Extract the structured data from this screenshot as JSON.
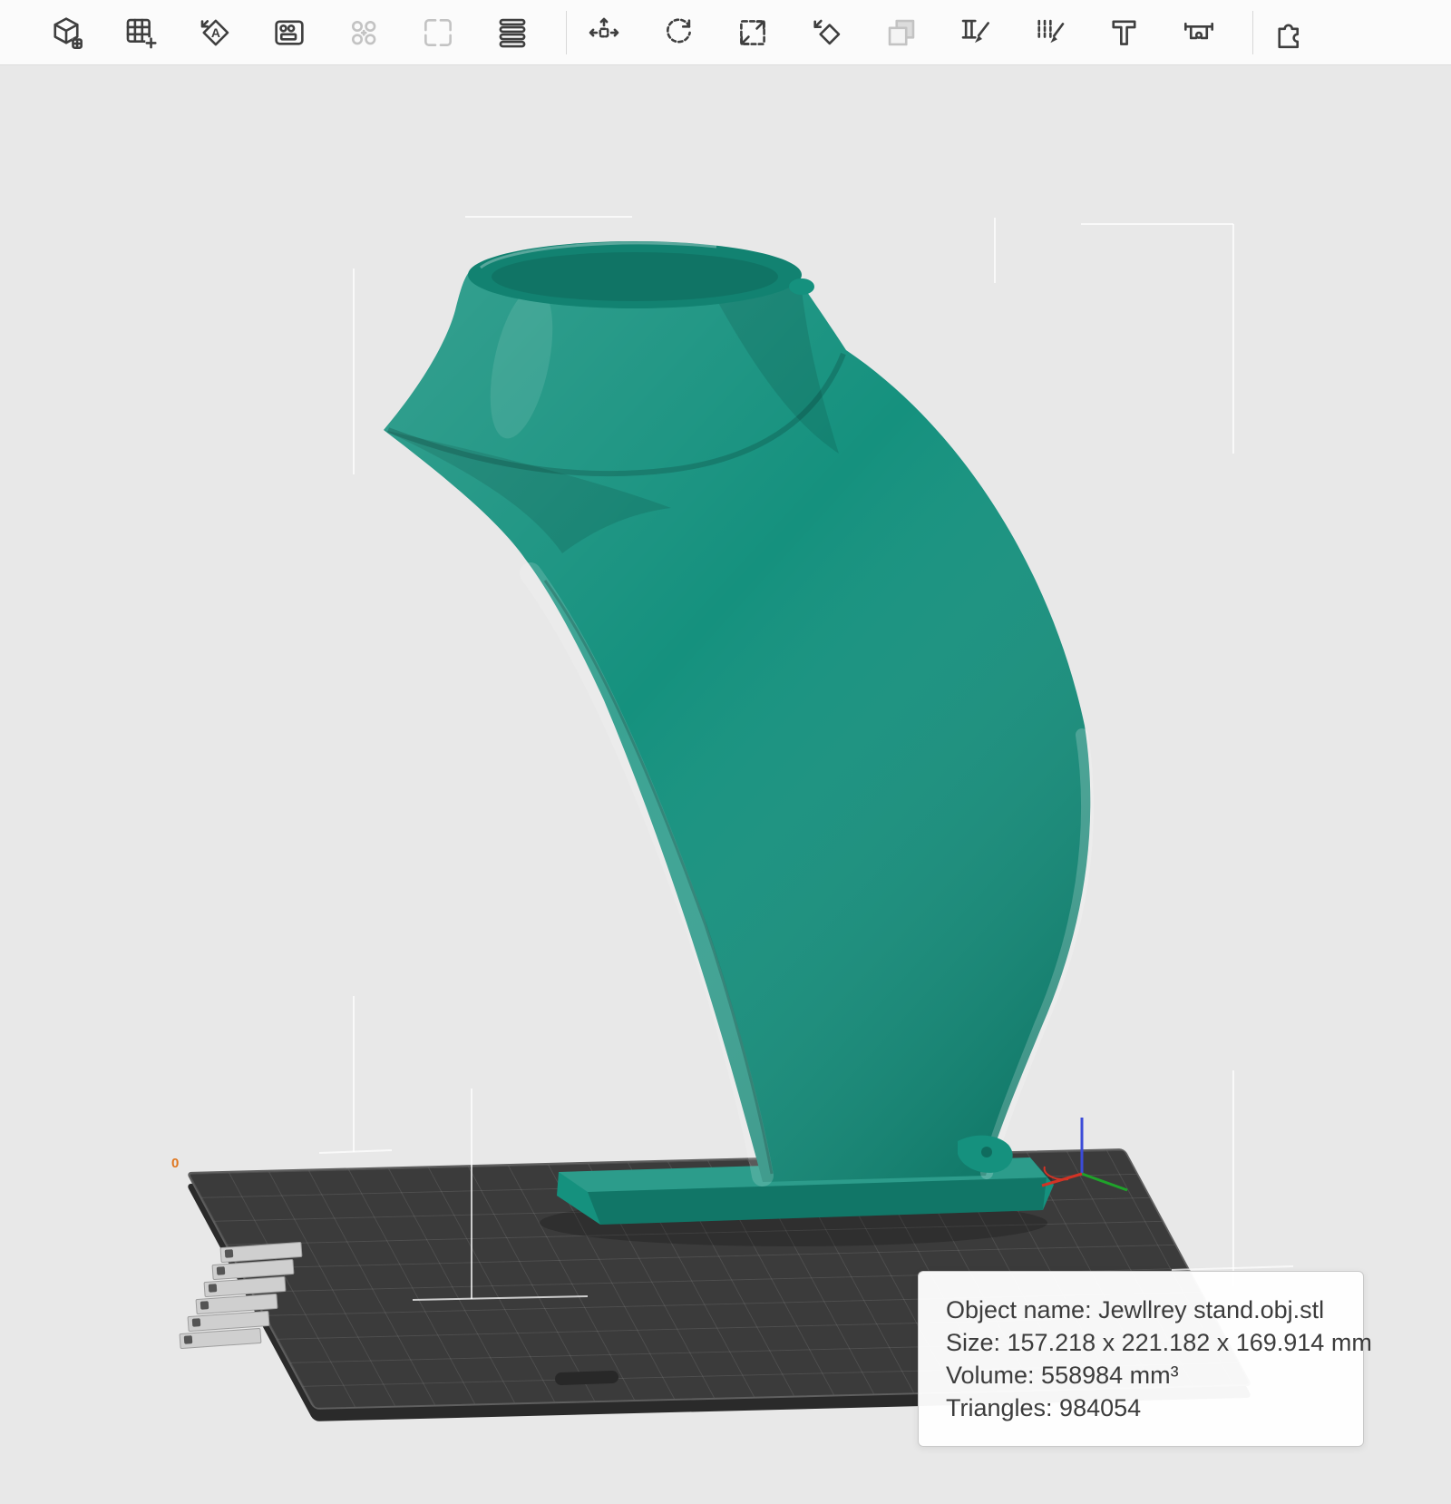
{
  "toolbar": {
    "auto_orient_letter": "A",
    "items": [
      {
        "name": "add-object",
        "disabled": false
      },
      {
        "name": "arrange",
        "disabled": false
      },
      {
        "name": "auto-orient",
        "disabled": false
      },
      {
        "name": "layout",
        "disabled": false
      },
      {
        "name": "clone",
        "disabled": true
      },
      {
        "name": "split",
        "disabled": true
      },
      {
        "name": "layers",
        "disabled": false
      },
      {
        "name": "move",
        "disabled": false
      },
      {
        "name": "rotate",
        "disabled": false
      },
      {
        "name": "scale",
        "disabled": false
      },
      {
        "name": "mirror",
        "disabled": false
      },
      {
        "name": "variable-layer-height",
        "disabled": true
      },
      {
        "name": "color-paint",
        "disabled": false
      },
      {
        "name": "support-paint",
        "disabled": false
      },
      {
        "name": "seam",
        "disabled": false
      },
      {
        "name": "measure",
        "disabled": false
      },
      {
        "name": "assembly",
        "disabled": false
      }
    ]
  },
  "viewport": {
    "origin_label": "0",
    "model_color": "#15917e",
    "plate_color": "#3b3b3b",
    "axis_colors": {
      "x": "#d23325",
      "y": "#1fa32a",
      "z": "#3b4bd8"
    }
  },
  "info_panel": {
    "lines": [
      "Object name: Jewllrey stand.obj.stl",
      "Size: 157.218 x 221.182 x 169.914 mm",
      "Volume: 558984 mm³",
      "Triangles: 984054"
    ]
  }
}
